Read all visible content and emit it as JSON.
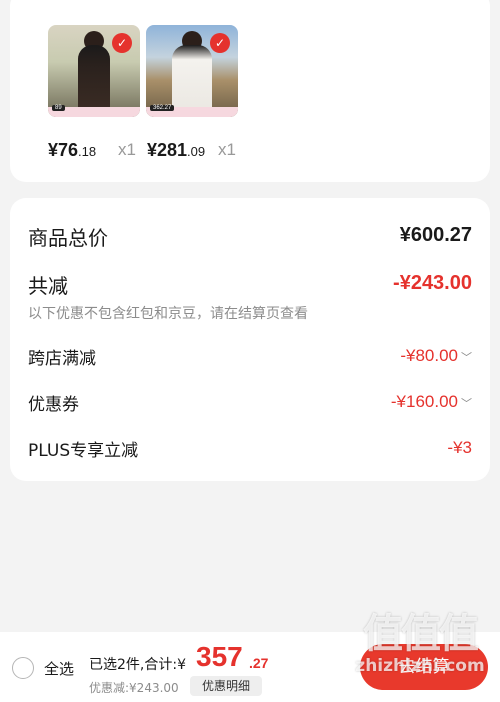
{
  "products": [
    {
      "tag": "89",
      "price_int": "¥76",
      "price_dec": ".18",
      "qty": "x1"
    },
    {
      "tag": "362.27",
      "price_int": "¥281",
      "price_dec": ".09",
      "qty": "x1"
    }
  ],
  "check_glyph": "✓",
  "summary": {
    "total_label": "商品总价",
    "total_value": "¥600.27",
    "reduce_label": "共减",
    "reduce_value": "-¥243.00",
    "note": "以下优惠不包含红包和京豆，请在结算页查看",
    "items": [
      {
        "label": "跨店满减",
        "value": "-¥80.00",
        "chevron": "﹀"
      },
      {
        "label": "优惠券",
        "value": "-¥160.00",
        "chevron": "﹀"
      },
      {
        "label": "PLUS专享立减",
        "value": "-¥3",
        "chevron": ""
      }
    ]
  },
  "bottom": {
    "select_all": "全选",
    "selected_text": "已选2件,合计:¥",
    "total_int": "357",
    "total_dec": ".27",
    "discount_text": "优惠减:¥243.00",
    "detail_button": "优惠明细",
    "checkout_button": "去结算"
  },
  "watermark": {
    "logo": "值值值",
    "url": "zhizhizhi.com"
  },
  "colors": {
    "accent": "#e5322d",
    "background": "#f3f3f3",
    "card": "#ffffff"
  }
}
